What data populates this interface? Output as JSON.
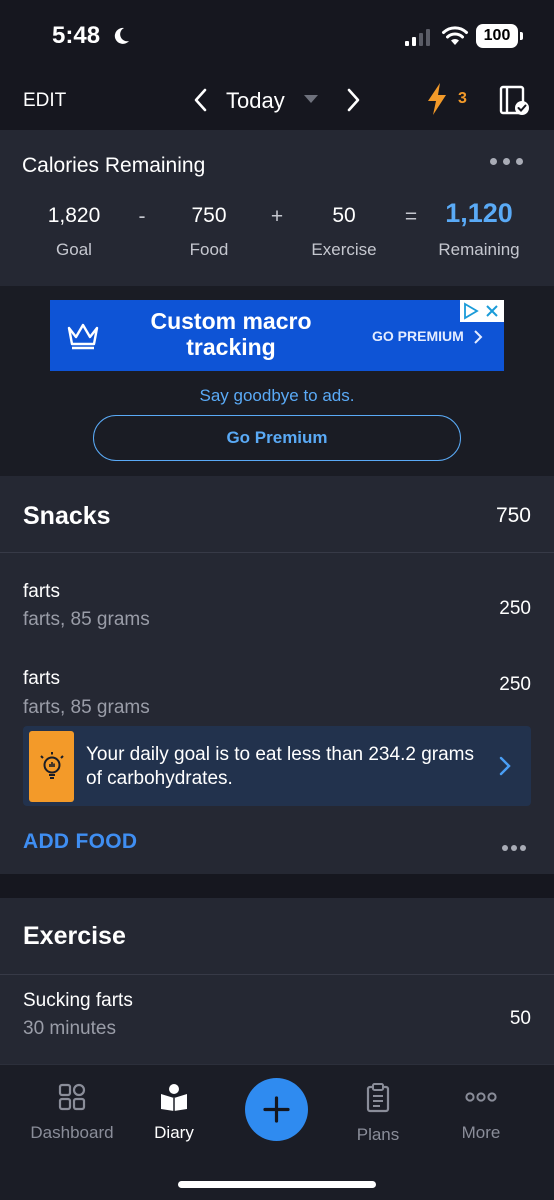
{
  "status_bar": {
    "time": "5:48",
    "battery": "100"
  },
  "nav": {
    "edit_label": "EDIT",
    "date_label": "Today",
    "streak_count": "3"
  },
  "calories": {
    "title": "Calories Remaining",
    "goal_value": "1,820",
    "goal_label": "Goal",
    "minus_op": "-",
    "food_value": "750",
    "food_label": "Food",
    "plus_op": "+",
    "exercise_value": "50",
    "exercise_label": "Exercise",
    "equals_op": "=",
    "remaining_value": "1,120",
    "remaining_label": "Remaining"
  },
  "ad": {
    "headline": "Custom macro tracking",
    "cta": "GO PREMIUM",
    "tagline": "Say goodbye to ads.",
    "premium_button": "Go Premium"
  },
  "snacks": {
    "title": "Snacks",
    "total": "750",
    "items": [
      {
        "name": "farts",
        "description": "farts, 85 grams",
        "calories": "250"
      },
      {
        "name": "farts",
        "description": "farts, 85 grams",
        "calories": "250"
      }
    ],
    "tip": "Your daily goal is to eat less than 234.2 grams of carbohydrates.",
    "add_food_label": "ADD FOOD"
  },
  "exercise": {
    "title": "Exercise",
    "items": [
      {
        "name": "Sucking farts",
        "duration": "30 minutes",
        "calories": "50"
      }
    ]
  },
  "tabs": [
    {
      "label": "Dashboard",
      "icon": "dashboard-grid-icon",
      "active": false
    },
    {
      "label": "Diary",
      "icon": "diary-book-icon",
      "active": true
    },
    {
      "label": "Plans",
      "icon": "clipboard-icon",
      "active": false
    },
    {
      "label": "More",
      "icon": "ellipsis-circles-icon",
      "active": false
    }
  ],
  "colors": {
    "background": "#16171f",
    "card": "#252833",
    "accent_blue": "#3f8ef2",
    "remaining_blue": "#5aaaf6",
    "streak_orange": "#f39a29",
    "ad_blue": "#0e54d6"
  }
}
